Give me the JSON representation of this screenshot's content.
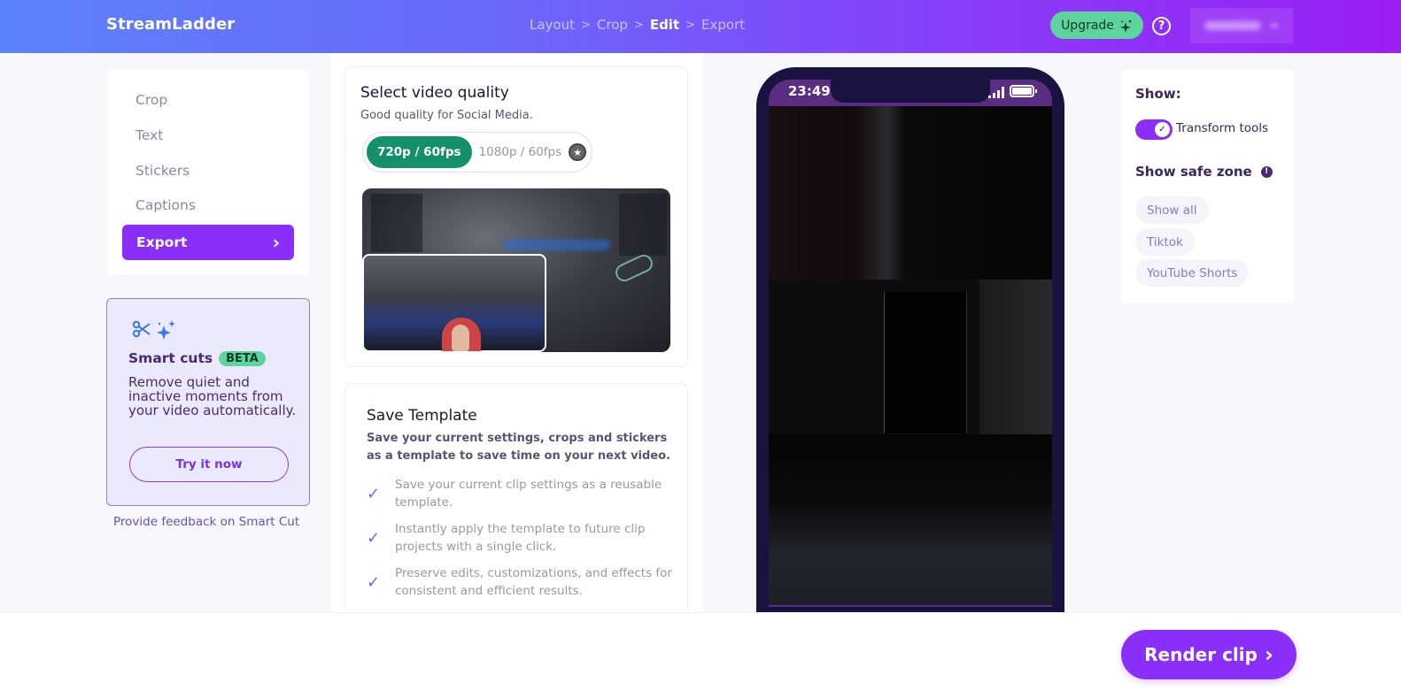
{
  "header": {
    "brand": "StreamLadder",
    "breadcrumbs": [
      {
        "label": "Layout",
        "active": false
      },
      {
        "label": "Crop",
        "active": false
      },
      {
        "label": "Edit",
        "active": true
      },
      {
        "label": "Export",
        "active": false
      }
    ],
    "upgrade_label": "Upgrade",
    "help_icon": "?",
    "colors": {
      "gradient_start": "#5b82fb",
      "gradient_end": "#9a1ff5",
      "upgrade_bg": "#5dd39e"
    }
  },
  "sidebar": {
    "items": [
      {
        "label": "Crop"
      },
      {
        "label": "Text"
      },
      {
        "label": "Stickers"
      },
      {
        "label": "Captions"
      },
      {
        "label": "Export",
        "active": true
      }
    ],
    "chevron": "›",
    "accent": "#8a2ffa"
  },
  "smart_cuts": {
    "title": "Smart cuts",
    "badge": "BETA",
    "description": "Remove quiet and inactive moments from your video automatically.",
    "button": "Try it now",
    "feedback_link": "Provide feedback on Smart Cut"
  },
  "video_quality": {
    "title": "Select video quality",
    "subtitle": "Good quality for Social Media.",
    "options": [
      {
        "label": "720p / 60fps",
        "selected": true
      },
      {
        "label": "1080p / 60fps",
        "selected": false,
        "premium": true
      }
    ],
    "premium_icon": "★"
  },
  "save_template": {
    "title": "Save Template",
    "subtitle": "Save your current settings, crops and stickers as a template to save time on your next video.",
    "check_icon": "✓",
    "features": [
      "Save your current clip settings as a reusable template.",
      "Instantly apply the template to future clip projects with a single click.",
      "Preserve edits, customizations, and effects for consistent and efficient results."
    ]
  },
  "phone_preview": {
    "time": "23:49"
  },
  "right_panel": {
    "show_label": "Show:",
    "transform_tools": {
      "label": "Transform tools",
      "enabled": true,
      "check": "✓"
    },
    "safe_zone_label": "Show safe zone",
    "info_icon": "!",
    "safe_zone_options": [
      "Show all",
      "Tiktok",
      "YouTube Shorts"
    ]
  },
  "footer": {
    "render_label": "Render clip",
    "render_chevron": "›"
  }
}
